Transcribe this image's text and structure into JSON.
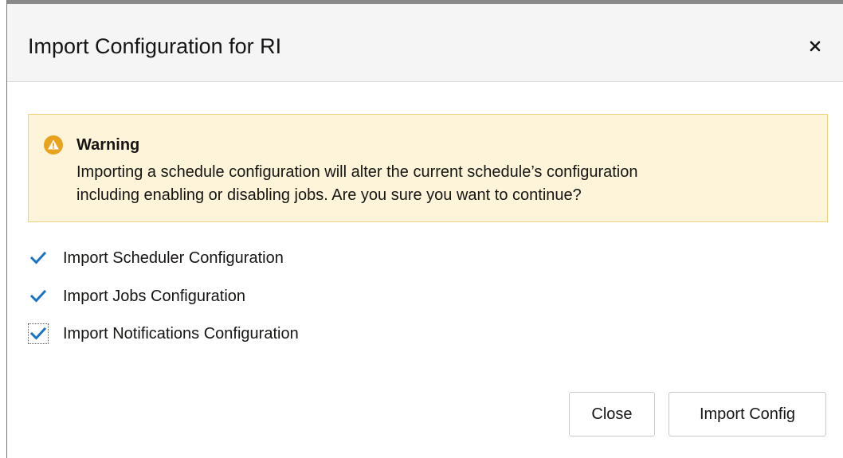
{
  "dialog": {
    "title": "Import Configuration for RI",
    "close_icon": "close-icon"
  },
  "warning": {
    "icon": "warning-triangle-icon",
    "title": "Warning",
    "message_line1": "Importing a schedule configuration will alter the current schedule’s configuration",
    "message_line2": "including enabling or disabling jobs. Are you sure you want to continue?"
  },
  "options": [
    {
      "label": "Import Scheduler Configuration",
      "checked": true
    },
    {
      "label": "Import Jobs Configuration",
      "checked": true
    },
    {
      "label": "Import Notifications Configuration",
      "checked": true
    }
  ],
  "buttons": {
    "close_label": "Close",
    "import_label": "Import Config"
  },
  "colors": {
    "accent": "#1a73c8",
    "warning_bg": "#fdf4d9",
    "warning_border": "#efd279",
    "warning_icon": "#e8a21c"
  }
}
